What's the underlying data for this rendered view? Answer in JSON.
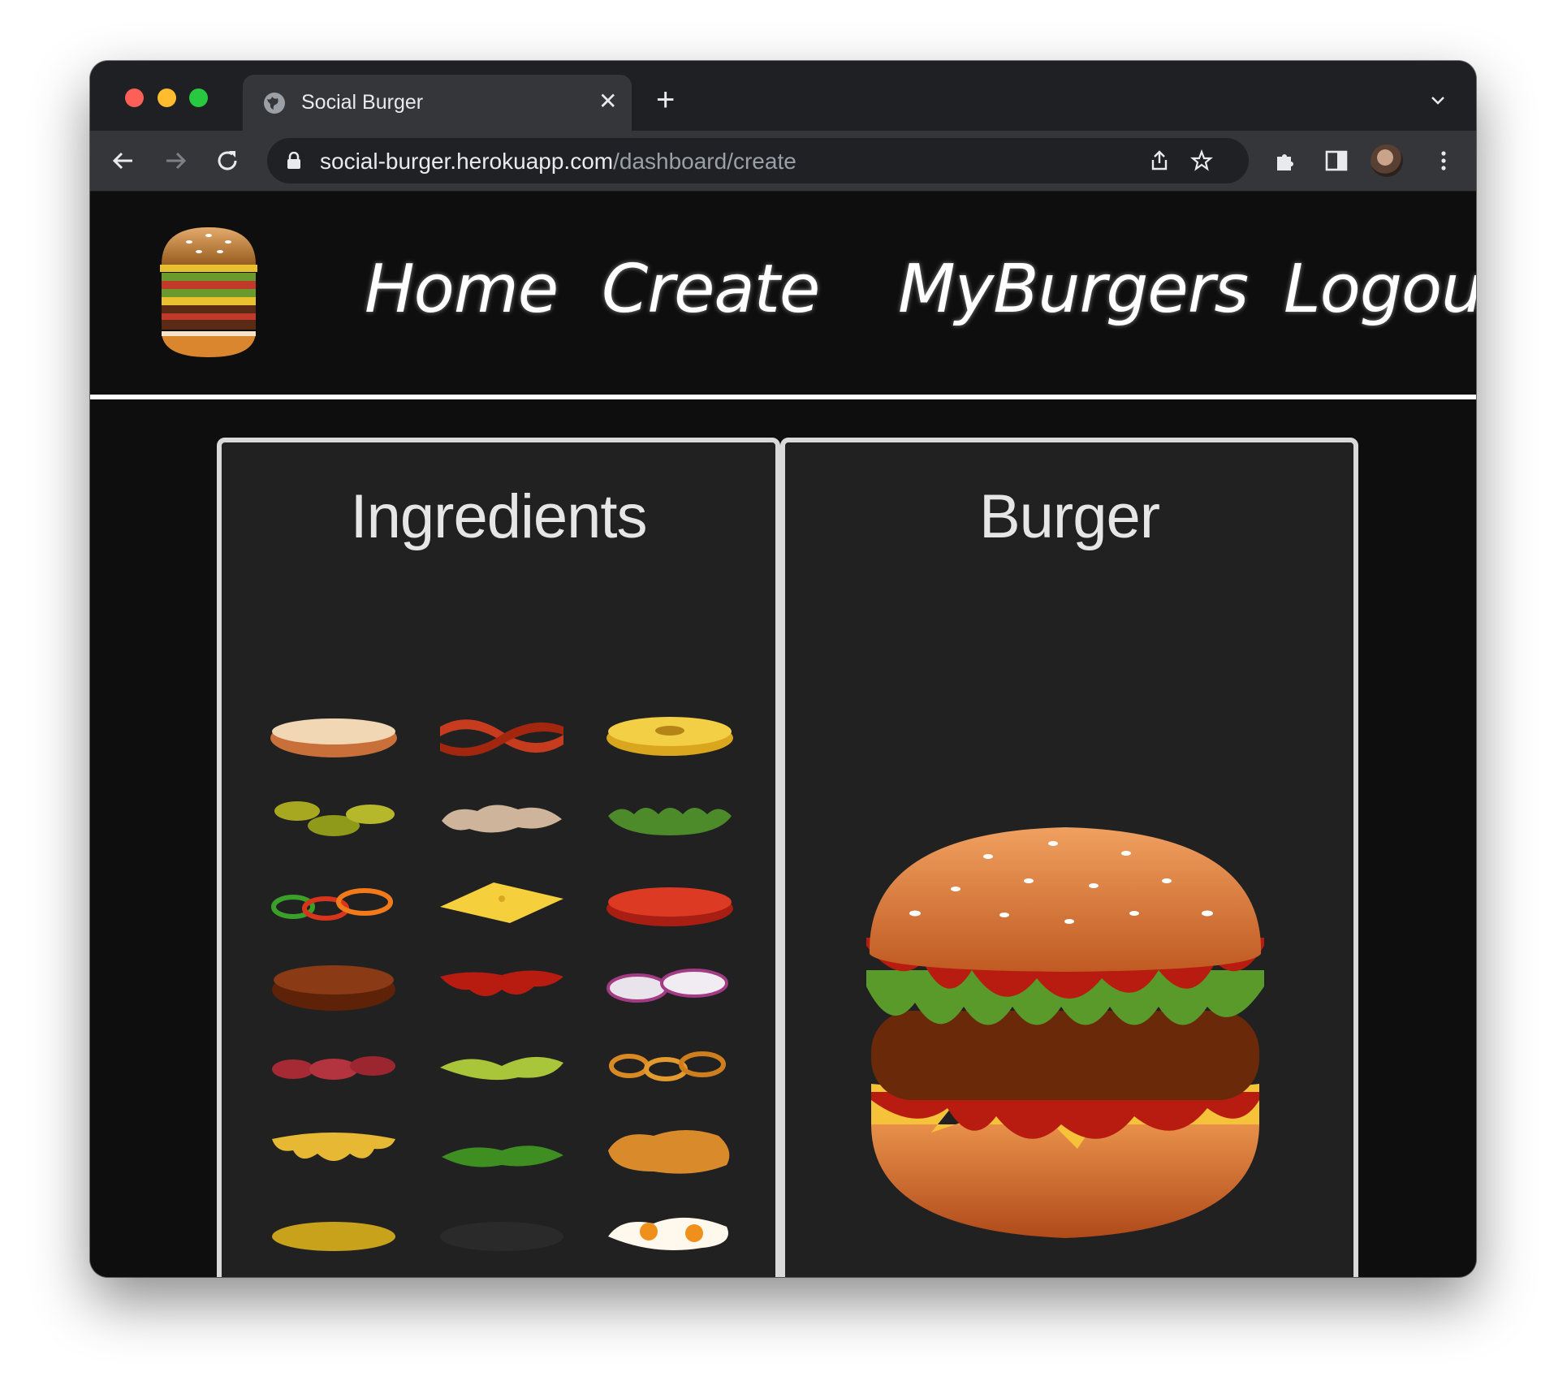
{
  "browser": {
    "tab_title": "Social Burger",
    "url_host": "social-burger.herokuapp.com",
    "url_path": "/dashboard/create"
  },
  "nav": {
    "links": [
      "Home",
      "Create",
      "MyBurgers",
      "Logout"
    ]
  },
  "panels": {
    "ingredients_title": "Ingredients",
    "burger_title": "Burger"
  },
  "ingredients": [
    "bun-bottom",
    "bacon",
    "pineapple",
    "pickles",
    "mushrooms",
    "lettuce",
    "peppers",
    "cheese-slice",
    "tomato",
    "beef-patty",
    "ketchup",
    "onion",
    "salami",
    "avocado",
    "onion-rings",
    "melted-cheese",
    "arugula",
    "fried-chicken",
    "corn",
    "olives",
    "fried-eggs"
  ],
  "colors": {
    "page_bg": "#0e0e0e",
    "panel_bg": "#212121",
    "panel_border": "#d9d9d9"
  }
}
